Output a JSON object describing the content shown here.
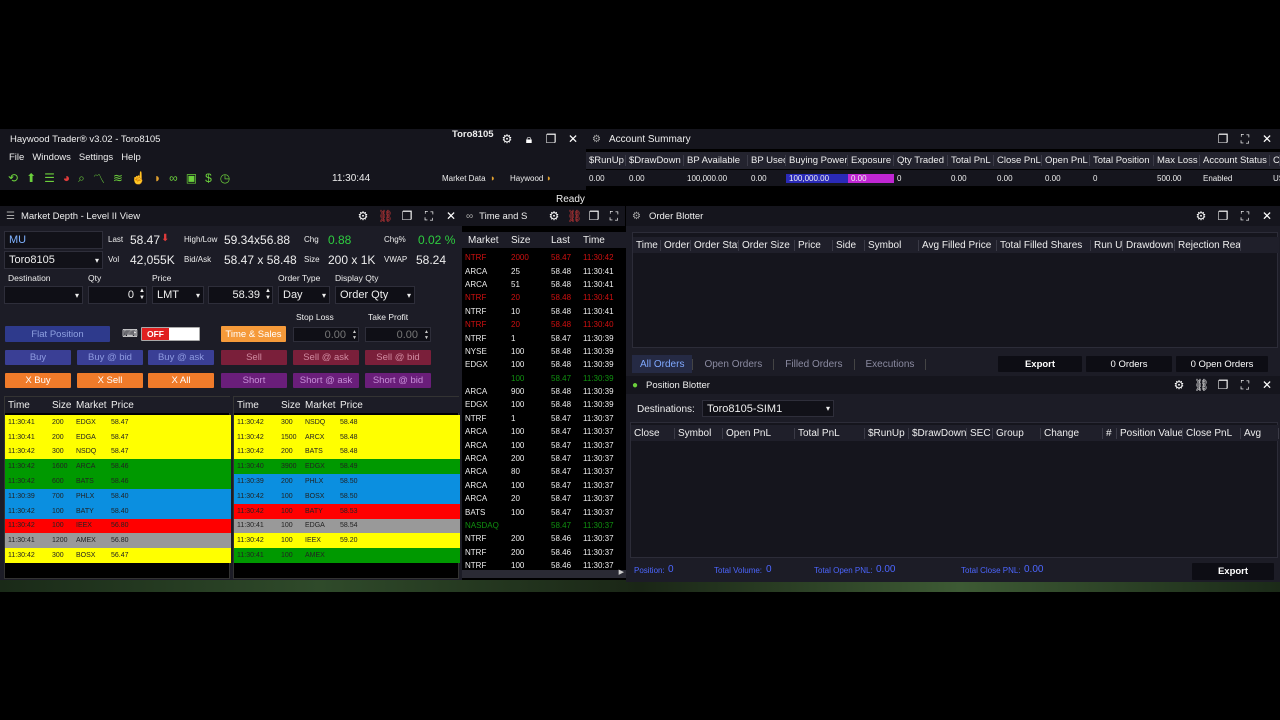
{
  "main": {
    "title": "Haywood Trader® v3.02 - Toro8105",
    "user": "Toro8105",
    "menu": [
      "File",
      "Windows",
      "Settings",
      "Help"
    ],
    "clock": "11:30:44",
    "market_data_label": "Market Data",
    "feed_label": "Haywood",
    "status": "Ready"
  },
  "account": {
    "title": "Account Summary",
    "headers": [
      "$RunUp",
      "$DrawDown",
      "BP Available",
      "BP Used",
      "Buying Power",
      "Exposure",
      "Qty Traded",
      "Total PnL",
      "Close PnL",
      "Open PnL",
      "Total Position",
      "Max Loss",
      "Account Status",
      "Cu"
    ],
    "values": [
      "0.00",
      "0.00",
      "100,000.00",
      "0.00",
      "100,000.00",
      "0.00",
      "0",
      "0.00",
      "0.00",
      "0.00",
      "0",
      "500.00",
      "Enabled",
      "USD"
    ]
  },
  "depth": {
    "title": "Market Depth - Level II View",
    "symbol": "MU",
    "account": "Toro8105",
    "last_label": "Last",
    "last": "58.47",
    "vol_label": "Vol",
    "vol": "42,055K",
    "hl_label": "High/Low",
    "hl": "59.34x56.88",
    "ba_label": "Bid/Ask",
    "ba": "58.47 x 58.48",
    "chg_label": "Chg",
    "chg": "0.88",
    "size_label": "Size",
    "size": "200 x 1K",
    "chgp_label": "Chg%",
    "chgp": "0.02 %",
    "vwap_label": "VWAP",
    "vwap": "58.24",
    "dest_label": "Destination",
    "qty_label": "Qty",
    "price_label": "Price",
    "ordtype_label": "Order Type",
    "dispqty_label": "Display Qty",
    "qty": "0",
    "ordtype": "LMT",
    "price": "58.39",
    "tif": "Day",
    "dispqty": "Order Qty",
    "stoploss_label": "Stop Loss",
    "takeprofit_label": "Take Profit",
    "stoploss": "0.00",
    "takeprofit": "0.00",
    "flat": "Flat Position",
    "toggle": "OFF",
    "ts_btn": "Time & Sales",
    "buy": "Buy",
    "buy_bid": "Buy @ bid",
    "buy_ask": "Buy @ ask",
    "sell": "Sell",
    "sell_ask": "Sell @ ask",
    "sell_bid": "Sell @ bid",
    "xbuy": "X Buy",
    "xsell": "X Sell",
    "xall": "X All",
    "short": "Short",
    "short_ask": "Short @ ask",
    "short_bid": "Short @ bid",
    "cols": [
      "Time",
      "Size",
      "Market",
      "Price"
    ],
    "bids": [
      {
        "t": "11:30:41",
        "s": "200",
        "m": "EDGX",
        "p": "58.47",
        "c": "#ffff00"
      },
      {
        "t": "11:30:41",
        "s": "200",
        "m": "EDGA",
        "p": "58.47",
        "c": "#ffff00"
      },
      {
        "t": "11:30:42",
        "s": "300",
        "m": "NSDQ",
        "p": "58.47",
        "c": "#ffff00"
      },
      {
        "t": "11:30:42",
        "s": "1600",
        "m": "ARCA",
        "p": "58.46",
        "c": "#009900"
      },
      {
        "t": "11:30:42",
        "s": "600",
        "m": "BATS",
        "p": "58.46",
        "c": "#009900"
      },
      {
        "t": "11:30:39",
        "s": "700",
        "m": "PHLX",
        "p": "58.40",
        "c": "#0b8fe0"
      },
      {
        "t": "11:30:42",
        "s": "100",
        "m": "BATY",
        "p": "58.40",
        "c": "#0b8fe0"
      },
      {
        "t": "11:30:42",
        "s": "100",
        "m": "IEEX",
        "p": "56.80",
        "c": "#ff0000"
      },
      {
        "t": "11:30:41",
        "s": "1200",
        "m": "AMEX",
        "p": "56.80",
        "c": "#999999"
      },
      {
        "t": "11:30:42",
        "s": "300",
        "m": "BOSX",
        "p": "56.47",
        "c": "#ffff00"
      }
    ],
    "asks": [
      {
        "t": "11:30:42",
        "s": "300",
        "m": "NSDQ",
        "p": "58.48",
        "c": "#ffff00"
      },
      {
        "t": "11:30:42",
        "s": "1500",
        "m": "ARCX",
        "p": "58.48",
        "c": "#ffff00"
      },
      {
        "t": "11:30:42",
        "s": "200",
        "m": "BATS",
        "p": "58.48",
        "c": "#ffff00"
      },
      {
        "t": "11:30:40",
        "s": "3900",
        "m": "EDGX",
        "p": "58.49",
        "c": "#009900"
      },
      {
        "t": "11:30:39",
        "s": "200",
        "m": "PHLX",
        "p": "58.50",
        "c": "#0b8fe0"
      },
      {
        "t": "11:30:42",
        "s": "100",
        "m": "BOSX",
        "p": "58.50",
        "c": "#0b8fe0"
      },
      {
        "t": "11:30:42",
        "s": "100",
        "m": "BATY",
        "p": "58.53",
        "c": "#ff0000"
      },
      {
        "t": "11:30:41",
        "s": "100",
        "m": "EDGA",
        "p": "58.54",
        "c": "#999999"
      },
      {
        "t": "11:30:42",
        "s": "100",
        "m": "IEEX",
        "p": "59.20",
        "c": "#ffff00"
      },
      {
        "t": "11:30:41",
        "s": "100",
        "m": "AMEX",
        "p": "",
        "c": "#009900"
      }
    ]
  },
  "ts": {
    "title": "Time and S",
    "cols": [
      "Market",
      "Size",
      "Last",
      "Time"
    ],
    "rows": [
      {
        "m": "NTRF",
        "s": "2000",
        "l": "58.47",
        "t": "11:30:42",
        "c": "#d01010"
      },
      {
        "m": "ARCA",
        "s": "25",
        "l": "58.48",
        "t": "11:30:41",
        "c": "#eeeeee"
      },
      {
        "m": "ARCA",
        "s": "51",
        "l": "58.48",
        "t": "11:30:41",
        "c": "#eeeeee"
      },
      {
        "m": "NTRF",
        "s": "20",
        "l": "58.48",
        "t": "11:30:41",
        "c": "#d01010"
      },
      {
        "m": "NTRF",
        "s": "10",
        "l": "58.48",
        "t": "11:30:41",
        "c": "#eeeeee"
      },
      {
        "m": "NTRF",
        "s": "20",
        "l": "58.48",
        "t": "11:30:40",
        "c": "#d01010"
      },
      {
        "m": "NTRF",
        "s": "1",
        "l": "58.47",
        "t": "11:30:39",
        "c": "#eeeeee"
      },
      {
        "m": "NYSE",
        "s": "100",
        "l": "58.48",
        "t": "11:30:39",
        "c": "#eeeeee"
      },
      {
        "m": "EDGX",
        "s": "100",
        "l": "58.48",
        "t": "11:30:39",
        "c": "#eeeeee"
      },
      {
        "m": "",
        "s": "100",
        "l": "58.47",
        "t": "11:30:39",
        "c": "#109010"
      },
      {
        "m": "ARCA",
        "s": "900",
        "l": "58.48",
        "t": "11:30:39",
        "c": "#eeeeee"
      },
      {
        "m": "EDGX",
        "s": "100",
        "l": "58.48",
        "t": "11:30:39",
        "c": "#eeeeee"
      },
      {
        "m": "NTRF",
        "s": "1",
        "l": "58.47",
        "t": "11:30:37",
        "c": "#eeeeee"
      },
      {
        "m": "ARCA",
        "s": "100",
        "l": "58.47",
        "t": "11:30:37",
        "c": "#eeeeee"
      },
      {
        "m": "ARCA",
        "s": "100",
        "l": "58.47",
        "t": "11:30:37",
        "c": "#eeeeee"
      },
      {
        "m": "ARCA",
        "s": "200",
        "l": "58.47",
        "t": "11:30:37",
        "c": "#eeeeee"
      },
      {
        "m": "ARCA",
        "s": "80",
        "l": "58.47",
        "t": "11:30:37",
        "c": "#eeeeee"
      },
      {
        "m": "ARCA",
        "s": "100",
        "l": "58.47",
        "t": "11:30:37",
        "c": "#eeeeee"
      },
      {
        "m": "ARCA",
        "s": "20",
        "l": "58.47",
        "t": "11:30:37",
        "c": "#eeeeee"
      },
      {
        "m": "BATS",
        "s": "100",
        "l": "58.47",
        "t": "11:30:37",
        "c": "#eeeeee"
      },
      {
        "m": "NASDAQ",
        "s": "",
        "l": "58.47",
        "t": "11:30:37",
        "c": "#109010"
      },
      {
        "m": "NTRF",
        "s": "200",
        "l": "58.46",
        "t": "11:30:37",
        "c": "#eeeeee"
      },
      {
        "m": "NTRF",
        "s": "200",
        "l": "58.46",
        "t": "11:30:37",
        "c": "#eeeeee"
      },
      {
        "m": "NTRF",
        "s": "100",
        "l": "58.46",
        "t": "11:30:37",
        "c": "#eeeeee"
      }
    ]
  },
  "orders": {
    "title": "Order Blotter",
    "cols": [
      "Time",
      "Order",
      "Order Stat",
      "Order Size",
      "Price",
      "Side",
      "Symbol",
      "Avg Filled Price",
      "Total Filled Shares",
      "Run Up",
      "Drawdown",
      "Rejection Reas"
    ],
    "tabs": [
      "All Orders",
      "Open Orders",
      "Filled Orders",
      "Executions"
    ],
    "export": "Export",
    "count": "0 Orders",
    "open_count": "0 Open Orders"
  },
  "positions": {
    "title": "Position Blotter",
    "dest_label": "Destinations:",
    "dest": "Toro8105-SIM1",
    "cols": [
      "Close",
      "Symbol",
      "Open PnL",
      "Total PnL",
      "$RunUp",
      "$DrawDown",
      "SEC",
      "Group",
      "Change",
      "#",
      "Position Value",
      "Close PnL",
      "Avg"
    ],
    "footer": {
      "position_label": "Position:",
      "position": "0",
      "volume_label": "Total Volume:",
      "volume": "0",
      "open_label": "Total Open PNL:",
      "open": "0.00",
      "close_label": "Total Close PNL:",
      "close": "0.00"
    },
    "export": "Export"
  }
}
